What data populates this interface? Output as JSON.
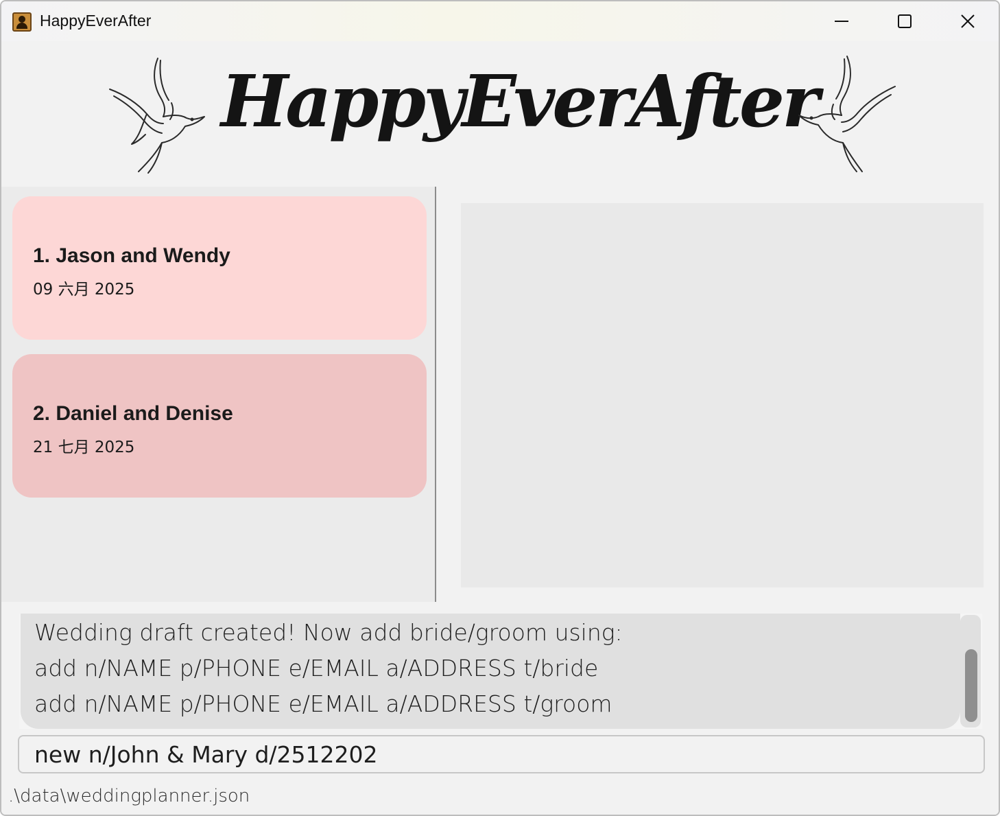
{
  "window": {
    "title": "HappyEverAfter",
    "icon": "address-book-icon"
  },
  "banner": {
    "logo_text": "HappyEverAfter",
    "decorations": [
      "dove-icon",
      "dove-icon"
    ]
  },
  "weddings": [
    {
      "title": "1. Jason and Wendy",
      "date": "09 六月 2025",
      "color": "#fdd7d6"
    },
    {
      "title": "2. Daniel and Denise",
      "date": "21 七月 2025",
      "color": "#efc4c4"
    }
  ],
  "result_display": {
    "lines": [
      "Wedding draft created! Now add bride/groom using:",
      "add n/NAME p/PHONE e/EMAIL a/ADDRESS t/bride",
      "add n/NAME p/PHONE e/EMAIL a/ADDRESS t/groom"
    ]
  },
  "command_box": {
    "value": "new n/John & Mary d/2512202"
  },
  "status_bar": {
    "file_path": ".\\data\\weddingplanner.json"
  }
}
